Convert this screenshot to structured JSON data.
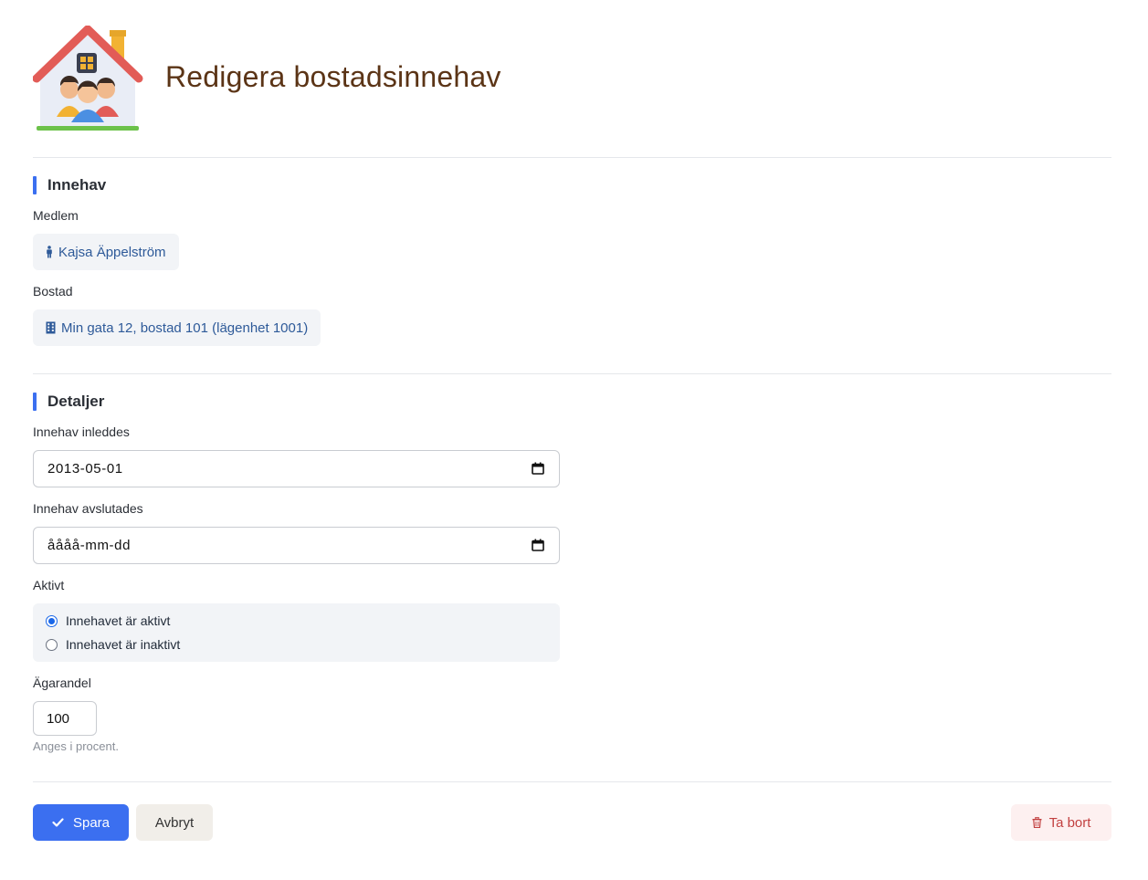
{
  "page": {
    "title": "Redigera bostadsinnehav"
  },
  "sections": {
    "holding": {
      "title": "Innehav"
    },
    "details": {
      "title": "Detaljer"
    }
  },
  "member": {
    "label": "Medlem",
    "value": "Kajsa Äppelström",
    "icon": "person-icon"
  },
  "residence": {
    "label": "Bostad",
    "value": "Min gata 12, bostad 101 (lägenhet 1001)",
    "icon": "building-icon"
  },
  "start_date": {
    "label": "Innehav inleddes",
    "value": "2013-05-01"
  },
  "end_date": {
    "label": "Innehav avslutades",
    "placeholder": "åååå-mm-dd"
  },
  "active": {
    "label": "Aktivt",
    "options": [
      {
        "label": "Innehavet är aktivt",
        "checked": true
      },
      {
        "label": "Innehavet är inaktivt",
        "checked": false
      }
    ]
  },
  "share": {
    "label": "Ägarandel",
    "value": "100",
    "help": "Anges i procent."
  },
  "actions": {
    "save": "Spara",
    "cancel": "Avbryt",
    "delete": "Ta bort"
  },
  "colors": {
    "primary": "#3b6ff0",
    "title": "#5b3416",
    "link": "#2e5a99",
    "danger": "#c24040"
  }
}
